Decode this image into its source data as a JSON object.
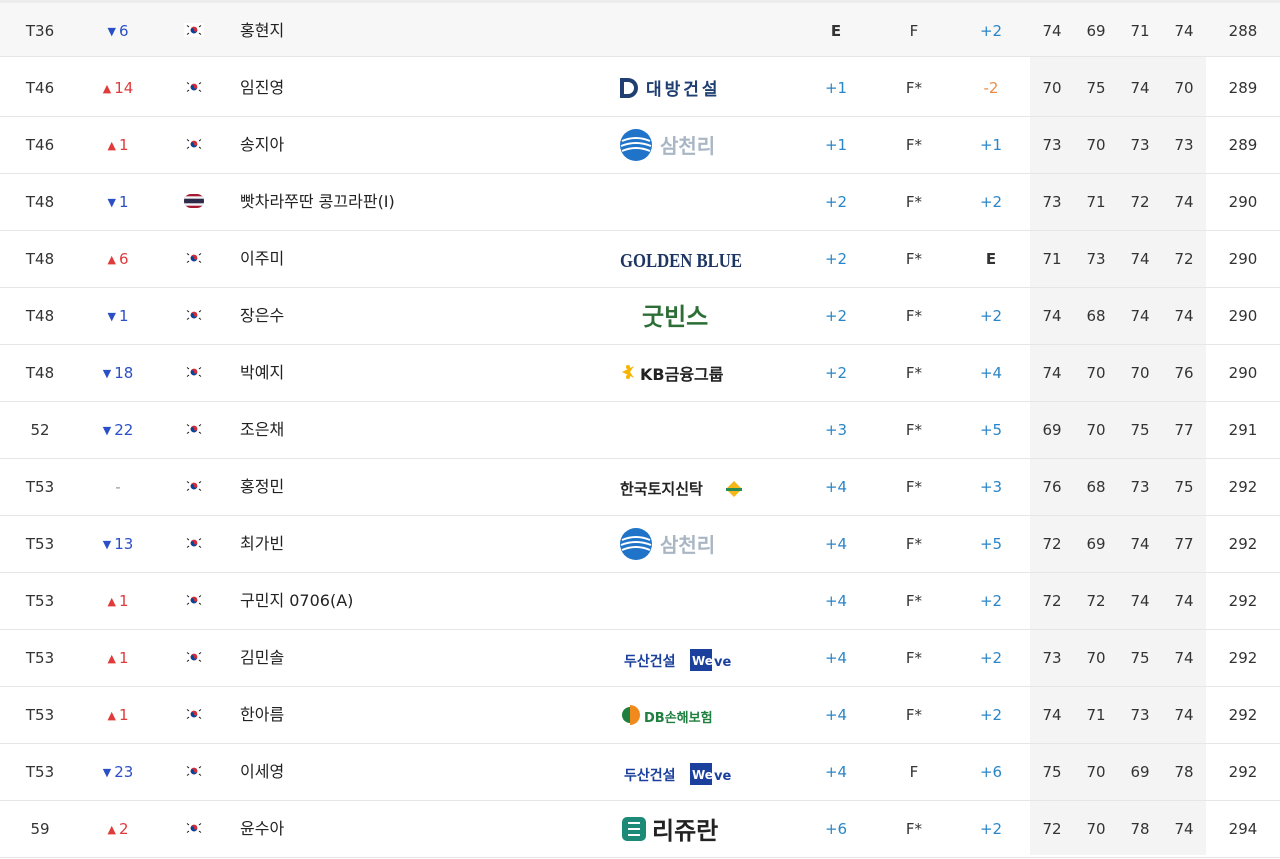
{
  "colors": {
    "up": "#e03b3b",
    "down": "#2b4fc7",
    "score_blue": "#2a86c8",
    "score_orange": "#e98c4a",
    "rounds_bg": "#f4f4f4"
  },
  "rows": [
    {
      "rank": "T36",
      "move": "6",
      "dir": "down",
      "flag": "kr",
      "name": "홍현지",
      "sponsor": "",
      "today": "E",
      "thru": "F",
      "topar": "+2",
      "r1": "74",
      "r2": "69",
      "r3": "71",
      "r4": "74",
      "total": "288"
    },
    {
      "rank": "T46",
      "move": "14",
      "dir": "up",
      "flag": "kr",
      "name": "임진영",
      "sponsor": "대방건설",
      "logo": "daebang",
      "today": "+1",
      "thru": "F*",
      "topar": "-2",
      "r1": "70",
      "r2": "75",
      "r3": "74",
      "r4": "70",
      "total": "289"
    },
    {
      "rank": "T46",
      "move": "1",
      "dir": "up",
      "flag": "kr",
      "name": "송지아",
      "sponsor": "삼천리",
      "logo": "samchully",
      "today": "+1",
      "thru": "F*",
      "topar": "+1",
      "r1": "73",
      "r2": "70",
      "r3": "73",
      "r4": "73",
      "total": "289"
    },
    {
      "rank": "T48",
      "move": "1",
      "dir": "down",
      "flag": "th",
      "name": "빳차라쭈딴 콩끄라판(I)",
      "sponsor": "",
      "today": "+2",
      "thru": "F*",
      "topar": "+2",
      "r1": "73",
      "r2": "71",
      "r3": "72",
      "r4": "74",
      "total": "290"
    },
    {
      "rank": "T48",
      "move": "6",
      "dir": "up",
      "flag": "kr",
      "name": "이주미",
      "sponsor": "GOLDEN BLUE",
      "logo": "goldenblue",
      "today": "+2",
      "thru": "F*",
      "topar": "E",
      "r1": "71",
      "r2": "73",
      "r3": "74",
      "r4": "72",
      "total": "290"
    },
    {
      "rank": "T48",
      "move": "1",
      "dir": "down",
      "flag": "kr",
      "name": "장은수",
      "sponsor": "굿빈스",
      "logo": "goodbeans",
      "today": "+2",
      "thru": "F*",
      "topar": "+2",
      "r1": "74",
      "r2": "68",
      "r3": "74",
      "r4": "74",
      "total": "290"
    },
    {
      "rank": "T48",
      "move": "18",
      "dir": "down",
      "flag": "kr",
      "name": "박예지",
      "sponsor": "KB금융그룹",
      "logo": "kb",
      "today": "+2",
      "thru": "F*",
      "topar": "+4",
      "r1": "74",
      "r2": "70",
      "r3": "70",
      "r4": "76",
      "total": "290"
    },
    {
      "rank": "52",
      "move": "22",
      "dir": "down",
      "flag": "kr",
      "name": "조은채",
      "sponsor": "",
      "today": "+3",
      "thru": "F*",
      "topar": "+5",
      "r1": "69",
      "r2": "70",
      "r3": "75",
      "r4": "77",
      "total": "291"
    },
    {
      "rank": "T53",
      "move": "-",
      "dir": "none",
      "flag": "kr",
      "name": "홍정민",
      "sponsor": "한국토지신탁",
      "logo": "kotrust",
      "today": "+4",
      "thru": "F*",
      "topar": "+3",
      "r1": "76",
      "r2": "68",
      "r3": "73",
      "r4": "75",
      "total": "292"
    },
    {
      "rank": "T53",
      "move": "13",
      "dir": "down",
      "flag": "kr",
      "name": "최가빈",
      "sponsor": "삼천리",
      "logo": "samchully",
      "today": "+4",
      "thru": "F*",
      "topar": "+5",
      "r1": "72",
      "r2": "69",
      "r3": "74",
      "r4": "77",
      "total": "292"
    },
    {
      "rank": "T53",
      "move": "1",
      "dir": "up",
      "flag": "kr",
      "name": "구민지 0706(A)",
      "sponsor": "",
      "today": "+4",
      "thru": "F*",
      "topar": "+2",
      "r1": "72",
      "r2": "72",
      "r3": "74",
      "r4": "74",
      "total": "292"
    },
    {
      "rank": "T53",
      "move": "1",
      "dir": "up",
      "flag": "kr",
      "name": "김민솔",
      "sponsor": "두산건설 We've",
      "logo": "doosan",
      "today": "+4",
      "thru": "F*",
      "topar": "+2",
      "r1": "73",
      "r2": "70",
      "r3": "75",
      "r4": "74",
      "total": "292"
    },
    {
      "rank": "T53",
      "move": "1",
      "dir": "up",
      "flag": "kr",
      "name": "한아름",
      "sponsor": "DB손해보험",
      "logo": "db",
      "today": "+4",
      "thru": "F*",
      "topar": "+2",
      "r1": "74",
      "r2": "71",
      "r3": "73",
      "r4": "74",
      "total": "292"
    },
    {
      "rank": "T53",
      "move": "23",
      "dir": "down",
      "flag": "kr",
      "name": "이세영",
      "sponsor": "두산건설 We've",
      "logo": "doosan",
      "today": "+4",
      "thru": "F",
      "topar": "+6",
      "r1": "75",
      "r2": "70",
      "r3": "69",
      "r4": "78",
      "total": "292"
    },
    {
      "rank": "59",
      "move": "2",
      "dir": "up",
      "flag": "kr",
      "name": "윤수아",
      "sponsor": "리쥬란",
      "logo": "rejuran",
      "today": "+6",
      "thru": "F*",
      "topar": "+2",
      "r1": "72",
      "r2": "70",
      "r3": "78",
      "r4": "74",
      "total": "294"
    }
  ]
}
